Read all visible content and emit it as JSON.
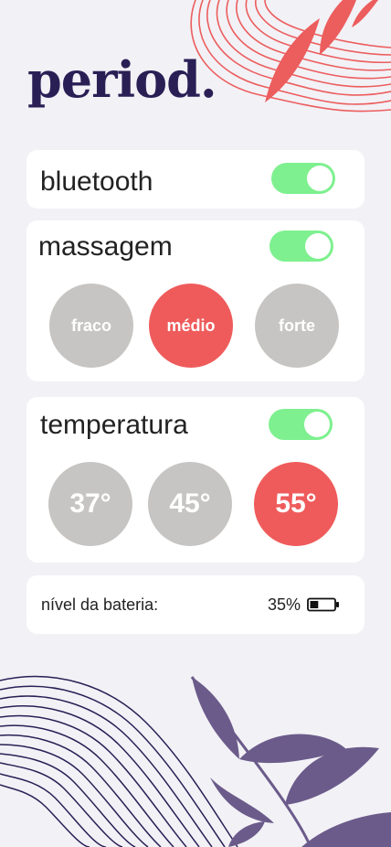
{
  "app": {
    "logo": "period."
  },
  "bluetooth": {
    "label": "bluetooth",
    "enabled": true
  },
  "massage": {
    "label": "massagem",
    "enabled": true,
    "levels": [
      "fraco",
      "médio",
      "forte"
    ],
    "selected": "médio"
  },
  "temperature": {
    "label": "temperatura",
    "enabled": true,
    "levels": [
      "37°",
      "45°",
      "55°"
    ],
    "selected": "55°"
  },
  "battery": {
    "label": "nível da bateria:",
    "value": "35%",
    "level": 0.35
  },
  "colors": {
    "accent": "#ef5b5b",
    "toggle_on": "#7ef08f",
    "inactive": "#c6c5c3",
    "brand": "#2a1f55",
    "background": "#f2f1f6"
  }
}
